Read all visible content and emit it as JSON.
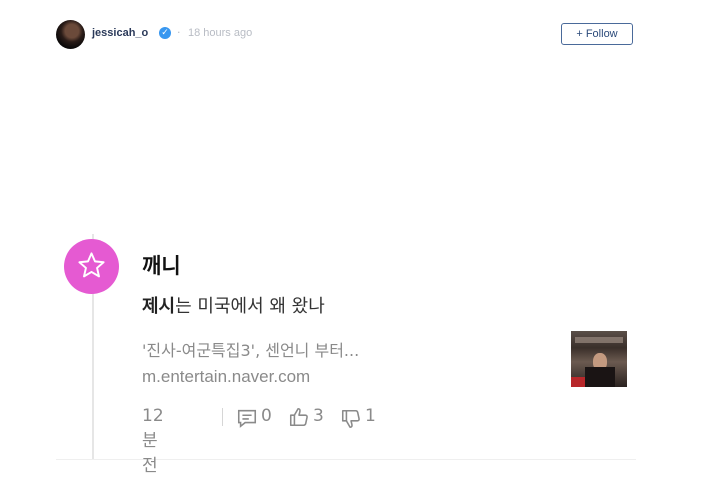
{
  "header": {
    "username": "jessicah_o",
    "verified_icon": "verified-badge-icon",
    "separator": "·",
    "timestamp": "18 hours ago",
    "follow_label": "+ Follow"
  },
  "card": {
    "author": "깨니",
    "headline_bold": "제시",
    "headline_rest": "는 미국에서 왜 왔나",
    "snippet": "'진사-여군특집3', 센언니 부터...",
    "domain": "m.entertain.naver.com",
    "time": "12분 전",
    "comments": "0",
    "likes": "3",
    "dislikes": "1"
  },
  "colors": {
    "accent_pink": "#e55ad2",
    "verified_blue": "#3897f0",
    "follow_border": "#4a6a9a"
  }
}
